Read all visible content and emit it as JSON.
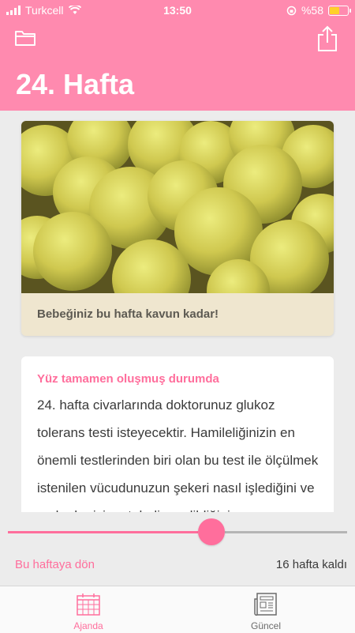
{
  "status_bar": {
    "carrier": "Turkcell",
    "time": "13:50",
    "battery_text": "%58",
    "battery_level": 0.58
  },
  "nav": {
    "title": "24. Hafta",
    "left_icon": "folder-icon",
    "right_icon": "share-icon"
  },
  "hero": {
    "caption": "Bebeğiniz bu hafta kavun kadar!",
    "image": "melons-photo"
  },
  "info_card": {
    "heading": "Yüz tamamen oluşmuş durumda",
    "body": "24. hafta civarlarında doktorunuz glukoz tolerans testi isteyecektir. Hamileliğinizin en önemli testlerinden biri olan bu test ile ölçülmek istenilen vücudunuzun şekeri nasıl işlediğini ve ne kadar iyi metabolize edildiğini"
  },
  "week_slider": {
    "current_week": 24,
    "max_week": 40,
    "back_link": "Bu haftaya dön",
    "weeks_left": "16 hafta kaldı"
  },
  "tab_bar": {
    "tabs": [
      {
        "label": "Ajanda",
        "icon": "calendar-icon",
        "active": true
      },
      {
        "label": "Güncel",
        "icon": "newspaper-icon",
        "active": false
      }
    ]
  },
  "colors": {
    "accent": "#ff8aaf",
    "accent_dark": "#ff6e9c",
    "inactive": "#6b6b6b"
  }
}
